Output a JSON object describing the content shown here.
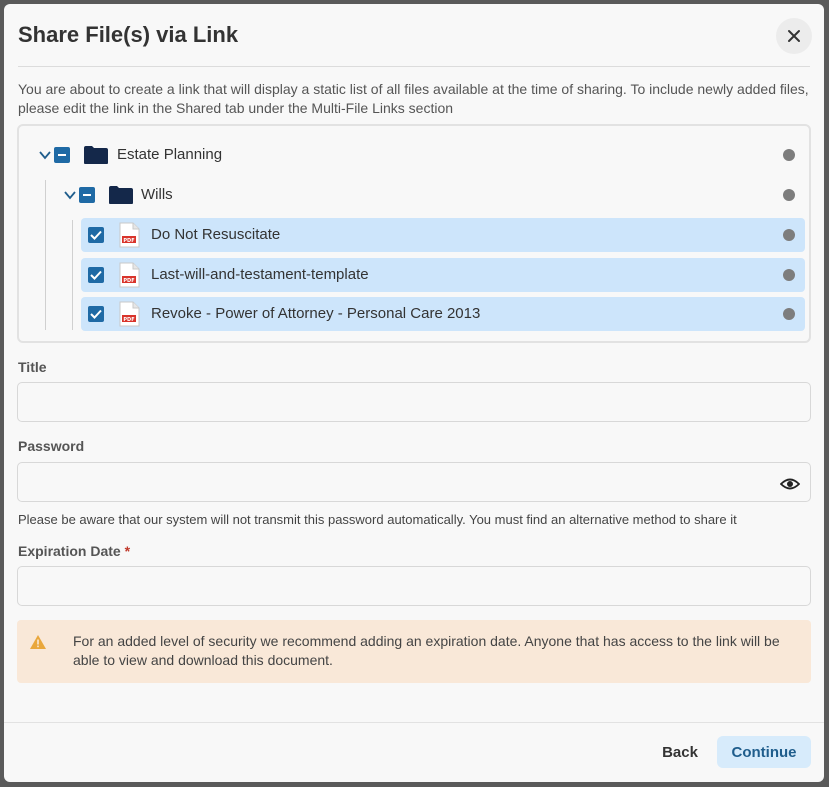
{
  "dialog": {
    "title": "Share File(s) via Link",
    "close_icon": "close-icon",
    "description": "You are about to create a link that will display a static list of all files available at the time of sharing. To include newly added files, please edit the link in the Shared tab under the Multi-File Links section"
  },
  "tree": {
    "root": {
      "label": "Estate Planning",
      "state": "partial"
    },
    "folder": {
      "label": "Wills",
      "state": "partial"
    },
    "files": [
      {
        "label": "Do Not Resuscitate",
        "checked": true,
        "icon": "pdf-icon"
      },
      {
        "label": "Last-will-and-testament-template",
        "checked": true,
        "icon": "pdf-icon"
      },
      {
        "label": "Revoke - Power of Attorney - Personal Care 2013",
        "checked": true,
        "icon": "pdf-icon"
      }
    ],
    "pdf_badge": "PDF"
  },
  "form": {
    "title_label": "Title",
    "title_value": "",
    "password_label": "Password",
    "password_value": "",
    "password_hint": "Please be aware that our system will not transmit this password automatically. You must find an alternative method to share it",
    "expiration_label": "Expiration Date",
    "expiration_required": "*",
    "expiration_value": ""
  },
  "warning": {
    "icon": "warning-icon",
    "text": "For an added level of security we recommend adding an expiration date. Anyone that has access to the link will be able to view and download this document."
  },
  "footer": {
    "back_label": "Back",
    "continue_label": "Continue"
  },
  "colors": {
    "checkbox": "#1f6aa5",
    "selected_row": "#cde5fb",
    "folder": "#14284a",
    "warning_bg": "#f9e8d8",
    "warning_icon": "#e9a73c",
    "continue_bg": "#d7ebfb",
    "continue_text": "#1f5d8c"
  }
}
